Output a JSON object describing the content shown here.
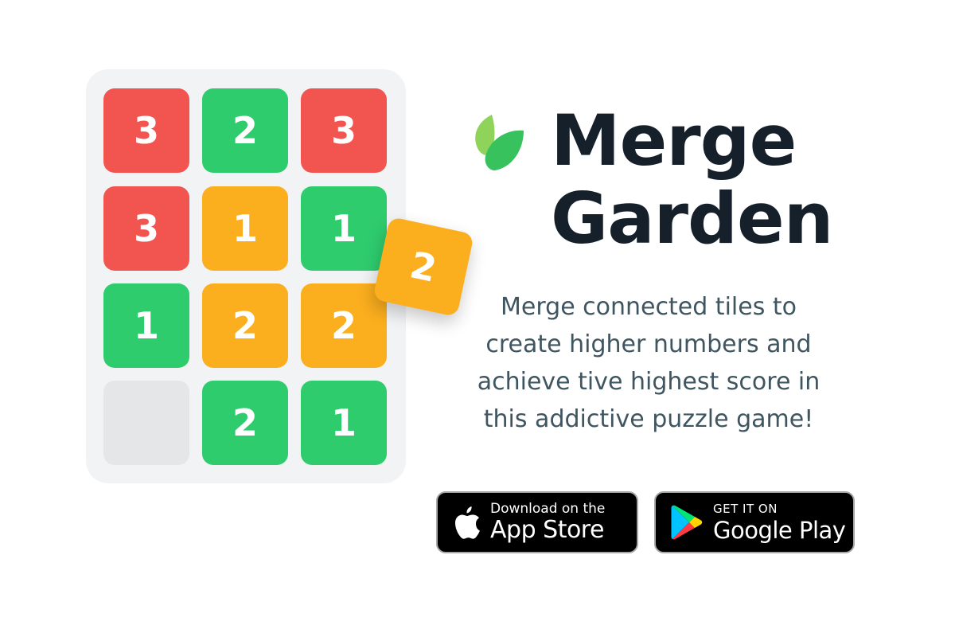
{
  "game": {
    "title_line1": "Merge",
    "title_line2": "Garden",
    "description": "Merge connected tiles to create higher numbers and achieve tive highest score in this addictive puzzle game!",
    "logo_icon": "leaf-icon",
    "colors": {
      "red_tile": "#f25450",
      "green_tile": "#2fcc6e",
      "yellow_tile": "#fbae1e",
      "empty_tile": "#e4e6e8",
      "board": "#f1f3f5",
      "title": "#16202a",
      "description": "#3f5560"
    }
  },
  "board": {
    "rows": [
      [
        {
          "value": "3",
          "color": "red"
        },
        {
          "value": "2",
          "color": "green"
        },
        {
          "value": "3",
          "color": "red"
        }
      ],
      [
        {
          "value": "3",
          "color": "red"
        },
        {
          "value": "1",
          "color": "yellow"
        },
        {
          "value": "1",
          "color": "green"
        }
      ],
      [
        {
          "value": "1",
          "color": "green"
        },
        {
          "value": "2",
          "color": "yellow"
        },
        {
          "value": "2",
          "color": "yellow"
        }
      ],
      [
        {
          "value": "",
          "color": "empty"
        },
        {
          "value": "2",
          "color": "green"
        },
        {
          "value": "1",
          "color": "green"
        }
      ]
    ],
    "floating_tile": {
      "value": "2",
      "color": "yellow"
    }
  },
  "badges": {
    "appstore": {
      "small_text": "Download on the",
      "large_text": "App Store",
      "icon": "apple-icon"
    },
    "googleplay": {
      "small_text": "GET IT ON",
      "large_text": "Google Play",
      "icon": "google-play-icon"
    }
  }
}
